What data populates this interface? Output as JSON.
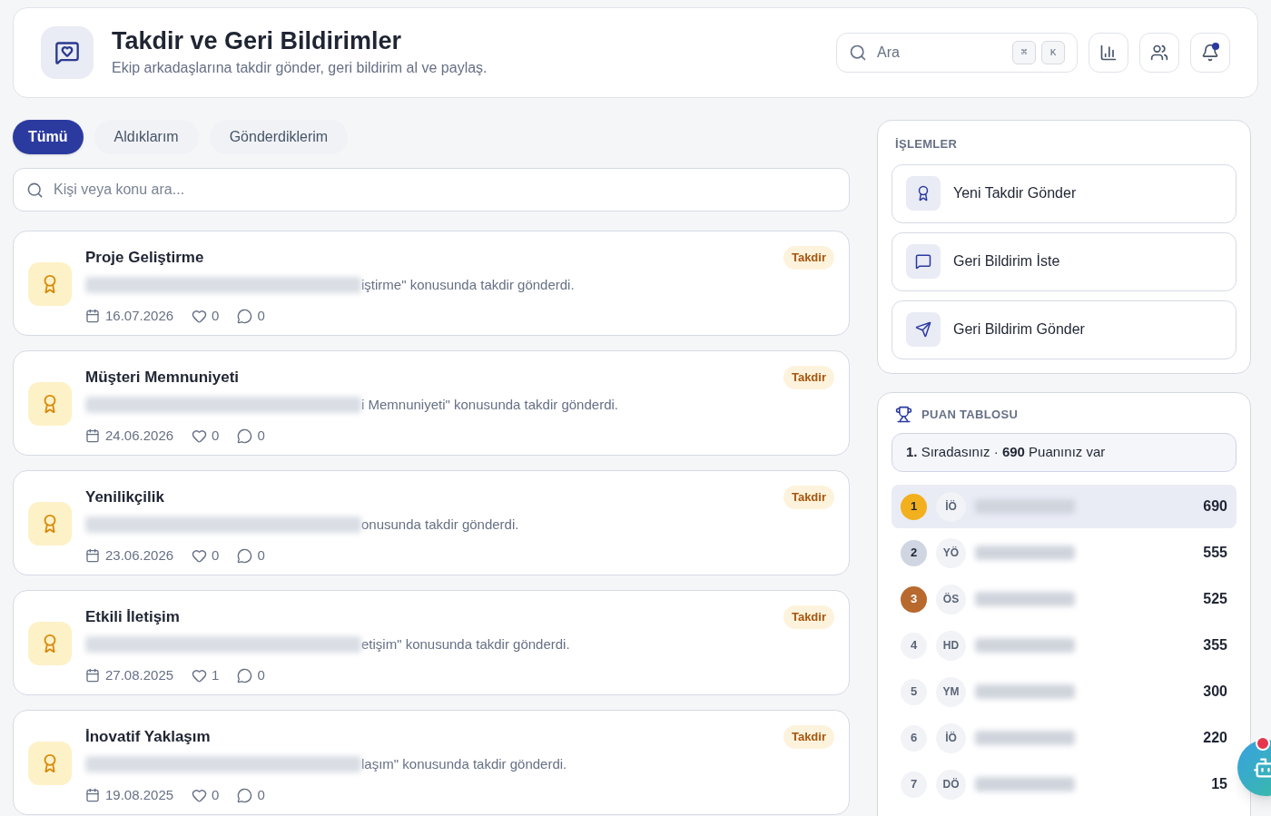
{
  "header": {
    "title": "Takdir ve Geri Bildirimler",
    "subtitle": "Ekip arkadaşlarına takdir gönder, geri bildirim al ve paylaş.",
    "search": {
      "placeholder": "Ara",
      "keys": [
        "⌘",
        "K"
      ]
    },
    "notification_dot": true
  },
  "tabs": [
    {
      "label": "Tümü",
      "selected": true
    },
    {
      "label": "Aldıklarım",
      "selected": false
    },
    {
      "label": "Gönderdiklerim",
      "selected": false
    }
  ],
  "filter": {
    "placeholder": "Kişi veya konu ara..."
  },
  "feed": [
    {
      "title": "Proje Geliştirme",
      "text": "iştirme\" konusunda takdir gönderdi.",
      "badge": "Takdir",
      "date": "16.07.2026",
      "likes": "0",
      "comments": "0"
    },
    {
      "title": "Müşteri Memnuniyeti",
      "text": "i Memnuniyeti\" konusunda takdir gönderdi.",
      "badge": "Takdir",
      "date": "24.06.2026",
      "likes": "0",
      "comments": "0"
    },
    {
      "title": "Yenilikçilik",
      "text": "onusunda takdir gönderdi.",
      "badge": "Takdir",
      "date": "23.06.2026",
      "likes": "0",
      "comments": "0"
    },
    {
      "title": "Etkili İletişim",
      "text": "etişim\" konusunda takdir gönderdi.",
      "badge": "Takdir",
      "date": "27.08.2025",
      "likes": "1",
      "comments": "0"
    },
    {
      "title": "İnovatif Yaklaşım",
      "text": "laşım\" konusunda takdir gönderdi.",
      "badge": "Takdir",
      "date": "19.08.2025",
      "likes": "0",
      "comments": "0"
    }
  ],
  "actions": {
    "title": "İŞLEMLER",
    "items": [
      {
        "label": "Yeni Takdir Gönder",
        "kind": "award"
      },
      {
        "label": "Geri Bildirim İste",
        "kind": "message"
      },
      {
        "label": "Geri Bildirim Gönder",
        "kind": "send"
      }
    ]
  },
  "leaderboard": {
    "title": "PUAN TABLOSU",
    "summary": "**1.** Sıradasınız · **690** Puanınız var",
    "rows": [
      {
        "rank": "1",
        "initials": "İÖ",
        "score": "690",
        "color": "#f2b01e",
        "selected": true
      },
      {
        "rank": "2",
        "initials": "YÖ",
        "score": "555",
        "color": "#cfd6e2",
        "selected": false
      },
      {
        "rank": "3",
        "initials": "ÖS",
        "score": "525",
        "color": "#b8692e",
        "selected": false
      },
      {
        "rank": "4",
        "initials": "HD",
        "score": "355",
        "color": "#f1f3f7",
        "selected": false
      },
      {
        "rank": "5",
        "initials": "YM",
        "score": "300",
        "color": "#f1f3f7",
        "selected": false
      },
      {
        "rank": "6",
        "initials": "İÖ",
        "score": "220",
        "color": "#f1f3f7",
        "selected": false
      },
      {
        "rank": "7",
        "initials": "DÖ",
        "score": "15",
        "color": "#f1f3f7",
        "selected": false
      }
    ]
  },
  "assistant_badge": true
}
